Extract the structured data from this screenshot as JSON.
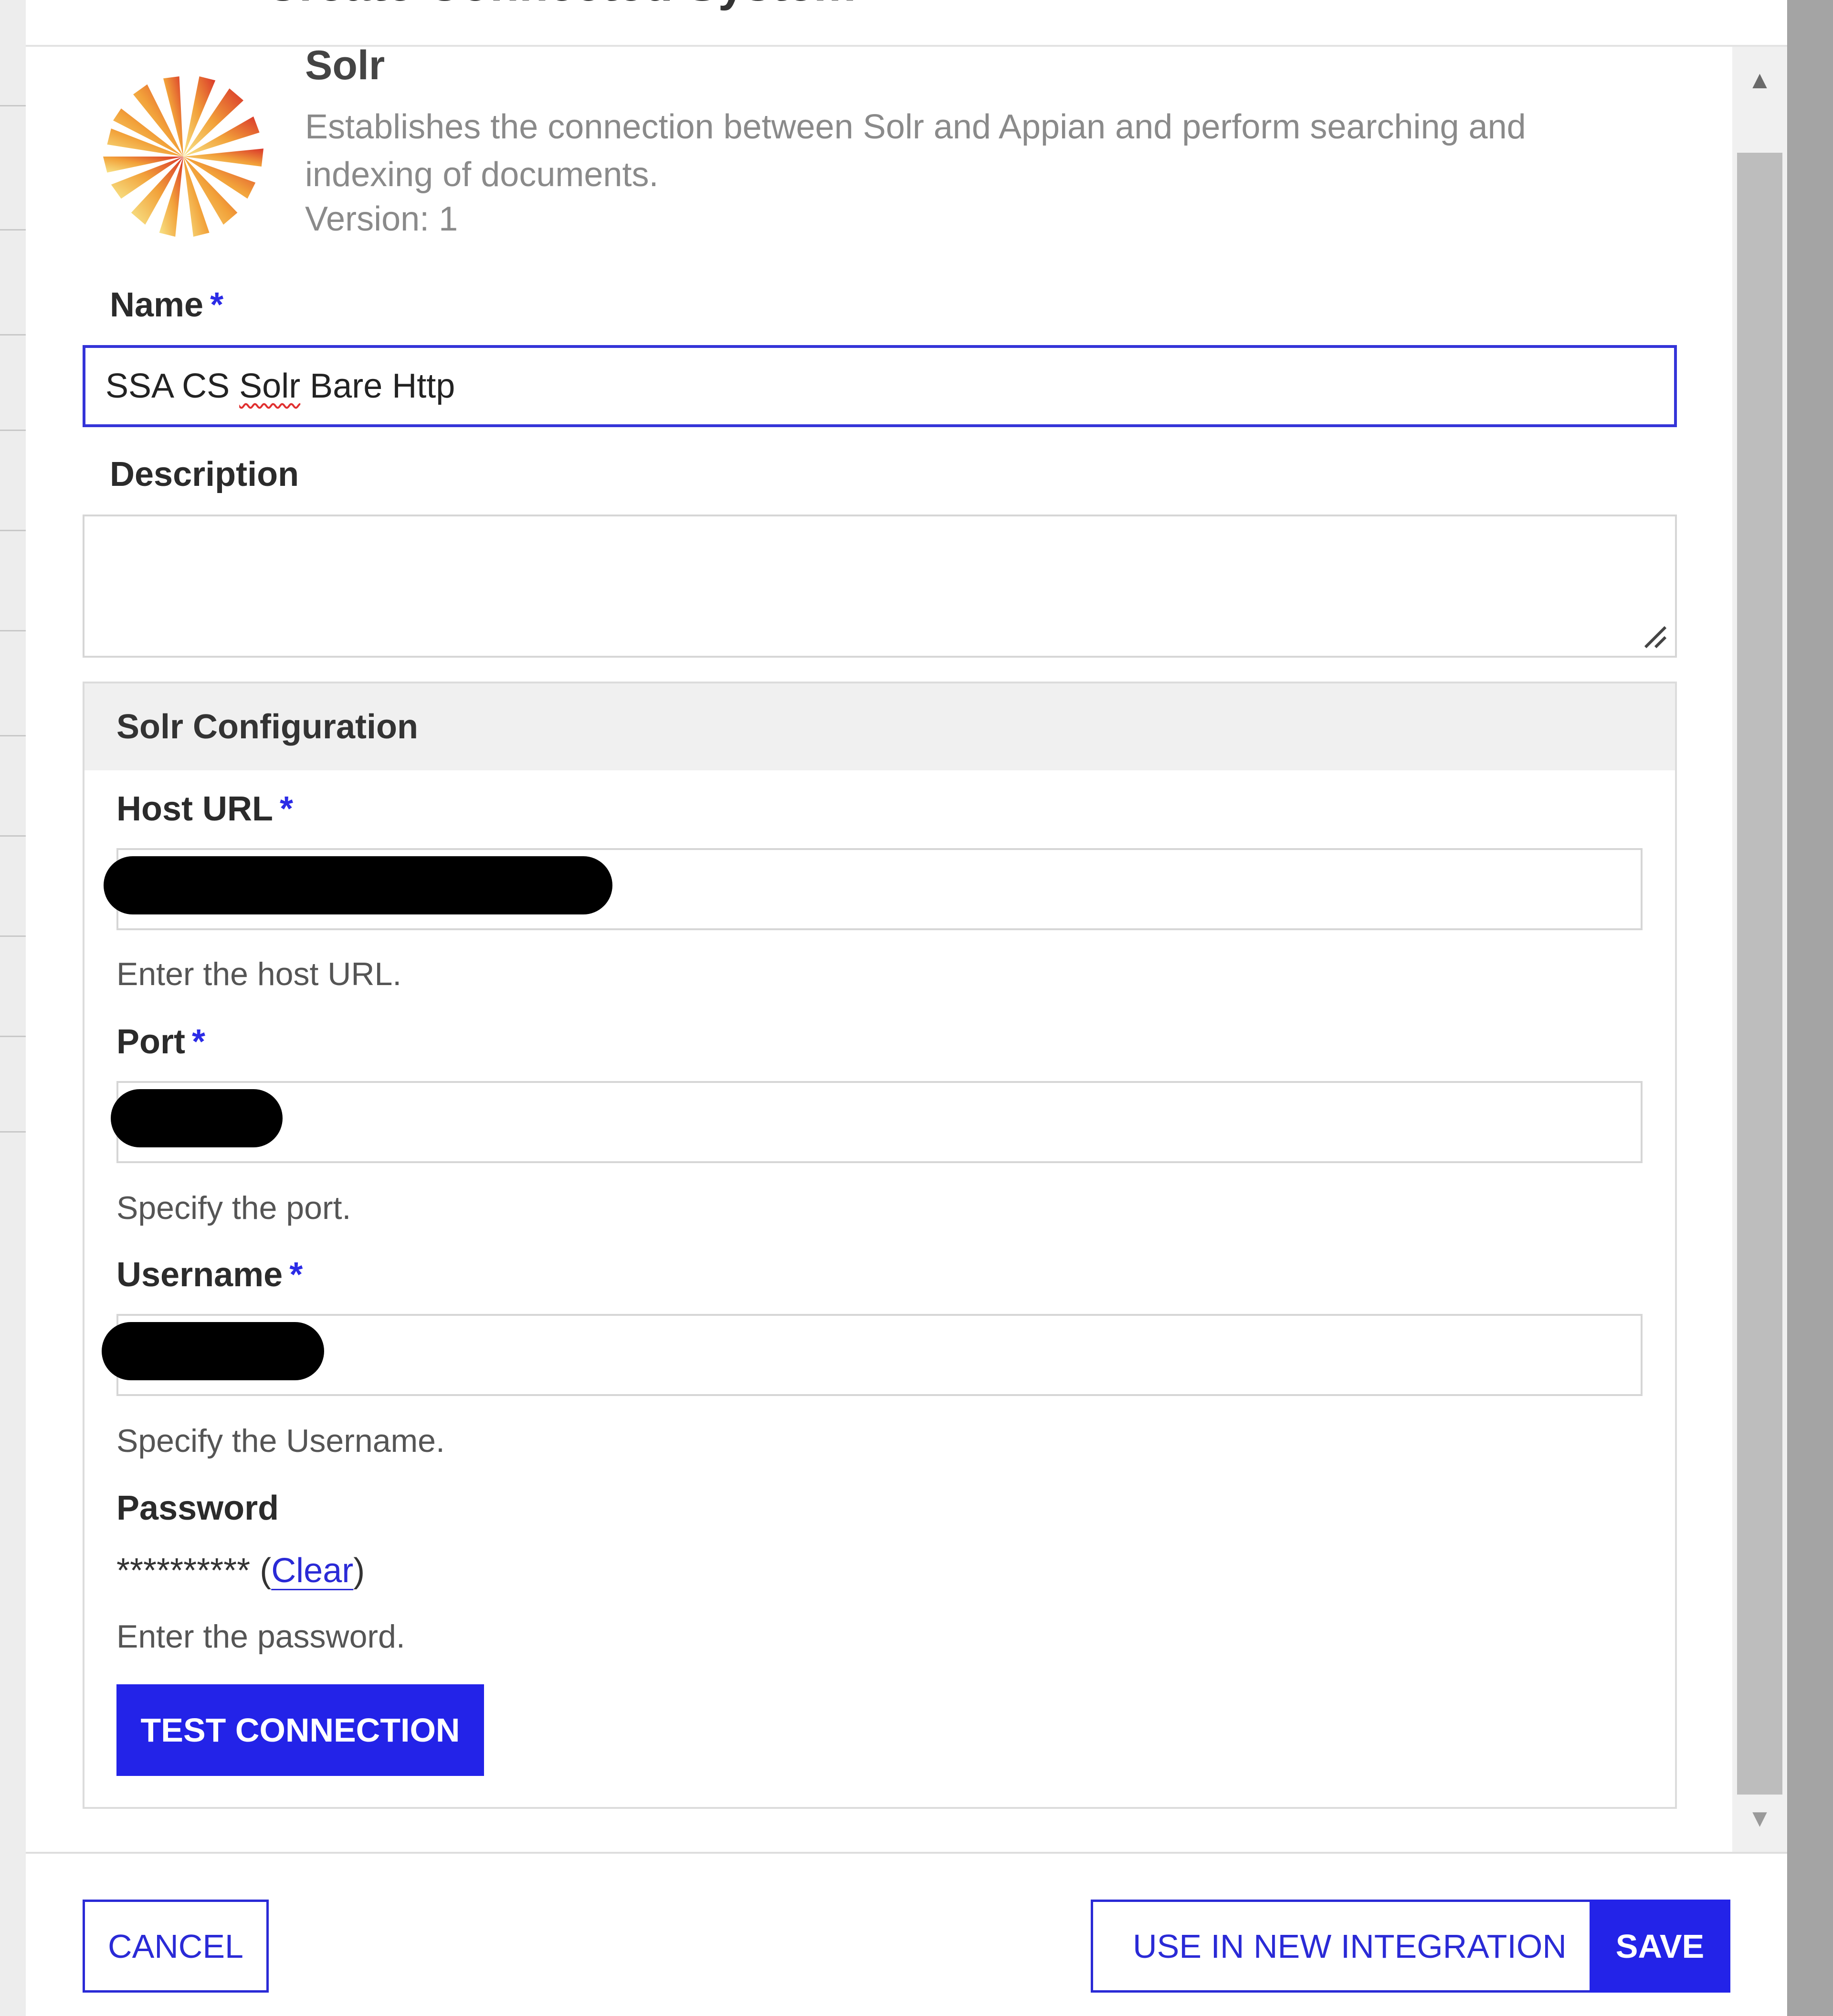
{
  "dialog": {
    "title": "Create Connected System"
  },
  "connector": {
    "name": "Solr",
    "description": "Establishes the connection between Solr and Appian and perform searching and indexing of documents.",
    "version": "Version: 1"
  },
  "form": {
    "name_label": "Name",
    "name_value_part1": "SSA CS ",
    "name_value_misspelled": "Solr",
    "name_value_part2": " Bare Http",
    "required_marker": "*",
    "description_label": "Description",
    "description_value": ""
  },
  "solr_config": {
    "section_title": "Solr Configuration",
    "host_url_label": "Host URL",
    "host_url_help": "Enter the host URL.",
    "port_label": "Port",
    "port_help": "Specify the port.",
    "username_label": "Username",
    "username_help": "Specify the Username.",
    "password_label": "Password",
    "password_mask": "**********",
    "clear_open": " (",
    "clear_label": "Clear",
    "clear_close": ")",
    "password_help": "Enter the password.",
    "test_button": "TEST CONNECTION"
  },
  "footer": {
    "cancel": "CANCEL",
    "use_in_integration": "USE IN NEW INTEGRATION",
    "save": "SAVE"
  },
  "colors": {
    "primary": "#2323e8",
    "required": "#2b2be6",
    "link": "#2a2ad6"
  },
  "icons": {
    "logo": "solr-sunburst-logo",
    "scroll_up": "caret-up-icon",
    "scroll_down": "caret-down-icon",
    "resize": "resize-handle-icon"
  }
}
